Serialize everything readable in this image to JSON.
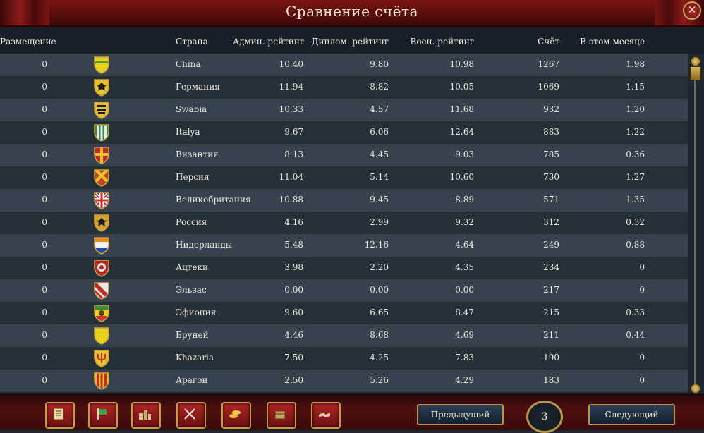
{
  "title": "Сравнение счёта",
  "header": {
    "placement": "Размещение",
    "country": "Страна",
    "admin": "Админ. рейтинг",
    "diplo": "Диплом. рейтинг",
    "mil": "Воен. рейтинг",
    "score": "Счёт",
    "month": "В этом месяце"
  },
  "rows": [
    {
      "place": "0",
      "country": "China",
      "admin": "10.40",
      "diplo": "9.80",
      "mil": "10.98",
      "score": "1267",
      "month": "1.98",
      "shield": {
        "main": "#e6d21c",
        "stripe": "#2e8a3a",
        "type": "plain"
      }
    },
    {
      "place": "0",
      "country": "Германия",
      "admin": "11.94",
      "diplo": "8.82",
      "mil": "10.05",
      "score": "1069",
      "month": "1.15",
      "shield": {
        "main": "#e8c22a",
        "stripe": "#1a1a1a",
        "type": "eagle"
      }
    },
    {
      "place": "0",
      "country": "Swabia",
      "admin": "10.33",
      "diplo": "4.57",
      "mil": "11.68",
      "score": "932",
      "month": "1.20",
      "shield": {
        "main": "#e8c22a",
        "stripe": "#1a1a1a",
        "type": "lions"
      }
    },
    {
      "place": "0",
      "country": "Italya",
      "admin": "9.67",
      "diplo": "6.06",
      "mil": "12.64",
      "score": "883",
      "month": "1.22",
      "shield": {
        "main": "#2f8a46",
        "stripe": "#e8e8e8",
        "type": "stripes"
      }
    },
    {
      "place": "0",
      "country": "Византия",
      "admin": "8.13",
      "diplo": "4.45",
      "mil": "9.03",
      "score": "785",
      "month": "0.36",
      "shield": {
        "main": "#c42a2a",
        "stripe": "#e8c22a",
        "type": "cross"
      }
    },
    {
      "place": "0",
      "country": "Персия",
      "admin": "11.04",
      "diplo": "5.14",
      "mil": "10.60",
      "score": "730",
      "month": "1.27",
      "shield": {
        "main": "#c4402a",
        "stripe": "#e8c22a",
        "type": "diag"
      }
    },
    {
      "place": "0",
      "country": "Великобритания",
      "admin": "10.88",
      "diplo": "9.45",
      "mil": "8.89",
      "score": "571",
      "month": "1.35",
      "shield": {
        "main": "#1f3a8a",
        "stripe": "#d42a2a",
        "type": "union"
      }
    },
    {
      "place": "0",
      "country": "Россия",
      "admin": "4.16",
      "diplo": "2.99",
      "mil": "9.32",
      "score": "312",
      "month": "0.32",
      "shield": {
        "main": "#d8a030",
        "stripe": "#1a1a1a",
        "type": "eagle"
      }
    },
    {
      "place": "0",
      "country": "Нидерланды",
      "admin": "5.48",
      "diplo": "12.16",
      "mil": "4.64",
      "score": "249",
      "month": "0.88",
      "shield": {
        "main": "#f08a20",
        "stripe": "#2a4aa0",
        "type": "tricolor"
      }
    },
    {
      "place": "0",
      "country": "Ацтеки",
      "admin": "3.98",
      "diplo": "2.20",
      "mil": "4.35",
      "score": "234",
      "month": "0",
      "shield": {
        "main": "#b02a2a",
        "stripe": "#e8e8e8",
        "type": "round"
      }
    },
    {
      "place": "0",
      "country": "Эльзас",
      "admin": "0.00",
      "diplo": "0.00",
      "mil": "0.00",
      "score": "217",
      "month": "0",
      "shield": {
        "main": "#e8e8e8",
        "stripe": "#c42a2a",
        "type": "bend"
      }
    },
    {
      "place": "0",
      "country": "Эфиопия",
      "admin": "9.60",
      "diplo": "6.65",
      "mil": "8.47",
      "score": "215",
      "month": "0.33",
      "shield": {
        "main": "#3a8a3a",
        "stripe": "#d43030",
        "type": "lion"
      }
    },
    {
      "place": "0",
      "country": "Бруней",
      "admin": "4.46",
      "diplo": "8.68",
      "mil": "4.69",
      "score": "211",
      "month": "0.44",
      "shield": {
        "main": "#e8d21c",
        "stripe": "#e8d21c",
        "type": "plain"
      }
    },
    {
      "place": "0",
      "country": "Khazaria",
      "admin": "7.50",
      "diplo": "4.25",
      "mil": "7.83",
      "score": "190",
      "month": "0",
      "shield": {
        "main": "#e8c22a",
        "stripe": "#c42a2a",
        "type": "trident"
      }
    },
    {
      "place": "0",
      "country": "Арагон",
      "admin": "2.50",
      "diplo": "5.26",
      "mil": "4.29",
      "score": "183",
      "month": "0",
      "shield": {
        "main": "#e8c22a",
        "stripe": "#c42a2a",
        "type": "pales"
      }
    }
  ],
  "footer": {
    "prev": "Предыдущий",
    "next": "Следующий",
    "page": "3",
    "buttons": [
      "ledger-icon",
      "flag-icon",
      "buildings-icon",
      "crossed-swords-icon",
      "coins-icon",
      "trade-goods-icon",
      "handshake-icon"
    ]
  }
}
